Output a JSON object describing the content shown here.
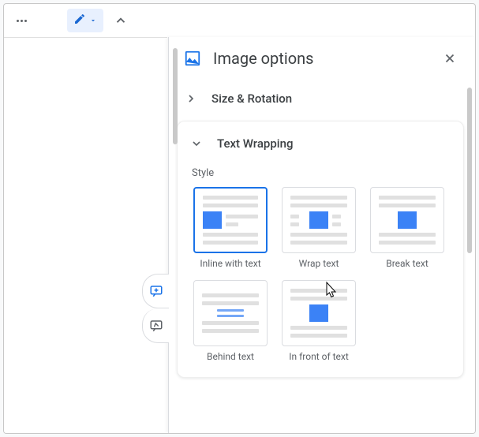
{
  "panel": {
    "title": "Image options",
    "sections": {
      "size_rotation": {
        "label": "Size & Rotation"
      },
      "text_wrapping": {
        "label": "Text Wrapping",
        "style_label": "Style",
        "options": {
          "inline": "Inline with text",
          "wrap": "Wrap text",
          "break": "Break text",
          "behind": "Behind text",
          "front": "In front of text"
        }
      }
    }
  }
}
